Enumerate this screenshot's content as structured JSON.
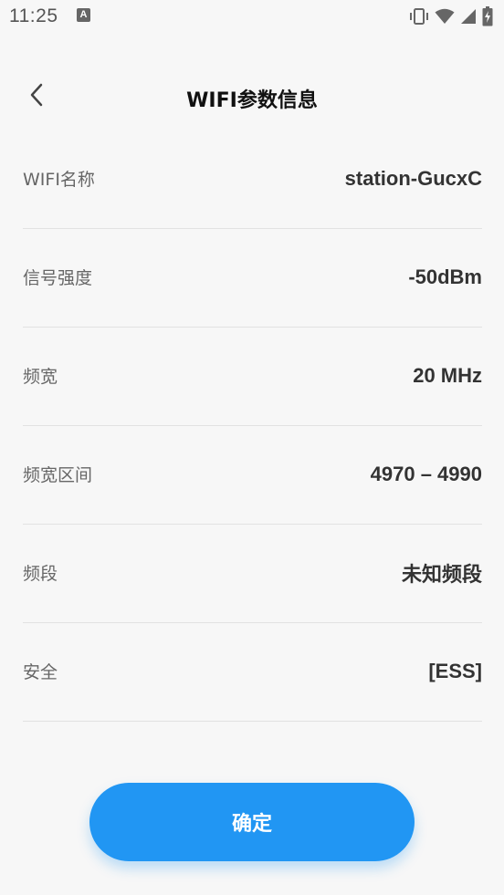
{
  "status_bar": {
    "time": "11:25",
    "notification_icon": "A",
    "icons": [
      "vibrate-icon",
      "wifi-icon",
      "cell-signal-icon",
      "battery-charging-icon"
    ]
  },
  "header": {
    "title": "WIFI参数信息",
    "back_icon": "chevron-left-icon"
  },
  "info_rows": [
    {
      "label": "WIFI名称",
      "value": "station-GucxC"
    },
    {
      "label": "信号强度",
      "value": "-50dBm"
    },
    {
      "label": "频宽",
      "value": "20 MHz"
    },
    {
      "label": "频宽区间",
      "value": "4970 – 4990"
    },
    {
      "label": "频段",
      "value": "未知频段"
    },
    {
      "label": "安全",
      "value": "[ESS]"
    }
  ],
  "confirm_button": {
    "label": "确定"
  },
  "colors": {
    "accent": "#2196f3",
    "background": "#f7f7f7",
    "divider": "#e2e2e2"
  }
}
